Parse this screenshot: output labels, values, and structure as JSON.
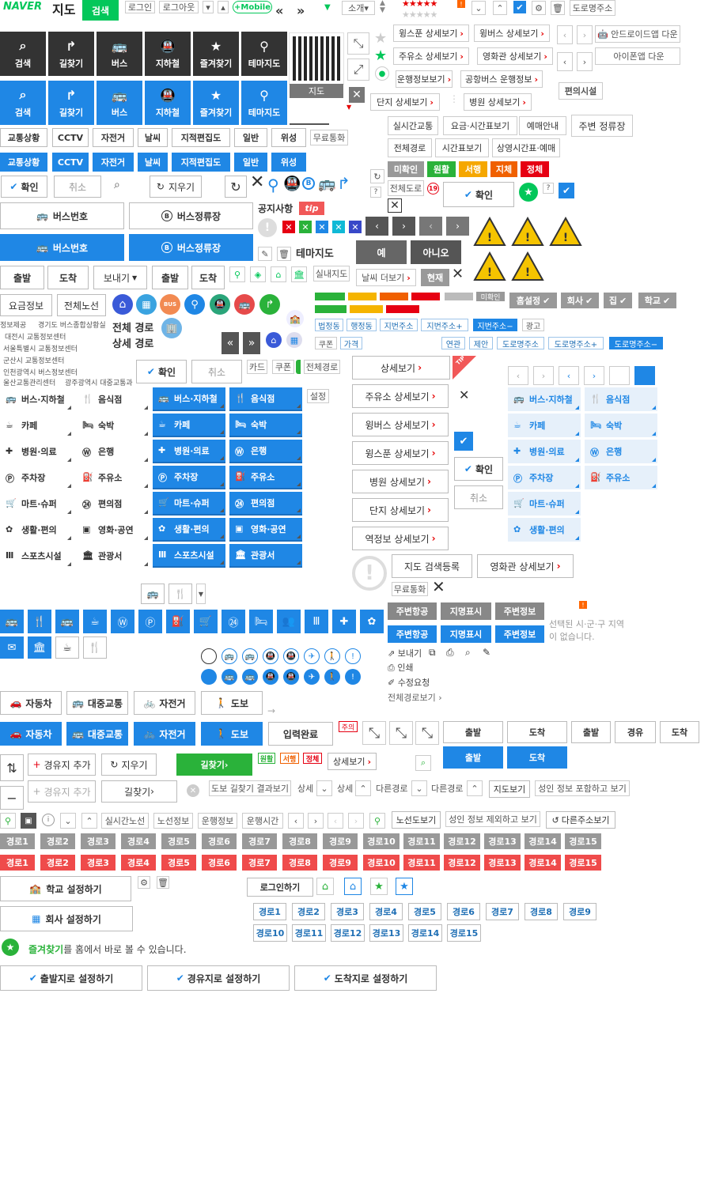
{
  "brand": {
    "naver": "NAVER",
    "title": "지도",
    "search": "검색"
  },
  "top": {
    "login": "로그인",
    "logout": "로그아웃",
    "mobile": "+Mobile",
    "intro": "소개",
    "road_addr": "도로명주소",
    "stars": "★★★★★"
  },
  "app": {
    "android": "안드로이드앱 다운",
    "iphone": "아이폰앱 다운"
  },
  "tiles": [
    "검색",
    "길찾기",
    "버스",
    "지하철",
    "즐겨찾기",
    "테마지도"
  ],
  "qr": {
    "label": "지도"
  },
  "detail_btns": [
    "윙스푼 상세보기",
    "윙버스 상세보기",
    "주유소 상세보기",
    "영화관 상세보기",
    "운행정보보기",
    "공항버스 운행정보",
    "단지 상세보기",
    "병원 상세보기"
  ],
  "conv": "편의시설",
  "traffic": [
    "교통상황",
    "CCTV",
    "자전거",
    "날씨",
    "지적편집도",
    "일반",
    "위성"
  ],
  "free_call": "무료통화",
  "sched": [
    "실시간교통",
    "요금·시간표보기",
    "예매안내",
    "주변 정류장",
    "전체경로",
    "시간표보기",
    "상영시간표·예매"
  ],
  "status": {
    "unknown": "미확인",
    "smooth": "원활",
    "slow": "서행",
    "delay": "지체",
    "jam": "정체"
  },
  "all_road": "전체도로",
  "age": "19",
  "confirm": "확인",
  "cancel": "취소",
  "erase": "지우기",
  "bus_no": "버스번호",
  "bus_stop": "버스정류장",
  "notice": "공지사항",
  "tip": "tip",
  "theme_map": "테마지도",
  "yes": "예",
  "no": "아니오",
  "depart": "출발",
  "arrive": "도착",
  "send": "보내기",
  "indoor": "실내지도",
  "weather_more": "날씨 더보기",
  "now": "현재",
  "fare": "요금정보",
  "all_line": "전체노선",
  "bus_icon": "BUS",
  "prefs": {
    "home": "홈설정",
    "work": "회사",
    "house": "집",
    "school": "학교"
  },
  "addr_tags": [
    "법정동",
    "행정동",
    "지번주소",
    "지번주소+",
    "지번주소−",
    "광고",
    "쿠폰",
    "가격",
    "연관",
    "제안",
    "도로명주소",
    "도로명주소+",
    "도로명주소−"
  ],
  "info_src": [
    "정보제공",
    "경기도 버스종합상황실",
    "대전시 교통정보센터",
    "서울특별시 교통정보센터",
    "군산시 교통정보센터",
    "인천광역시 버스정보센터",
    "울산교통관리센터",
    "광주광역시 대중교통과"
  ],
  "route": {
    "all": "전체 경로",
    "detail": "상세 경로"
  },
  "card": "카드",
  "coupon": "쿠폰",
  "all_route": "전체경로",
  "settings": "설정",
  "detail_view": "상세보기",
  "tip_badge": "TIP",
  "places": [
    "버스·지하철",
    "음식점",
    "카페",
    "숙박",
    "병원·의료",
    "은행",
    "주차장",
    "주유소",
    "마트·슈퍼",
    "편의점",
    "생활·편의",
    "영화·공연",
    "스포츠시설",
    "관광서"
  ],
  "detail_col": [
    "주유소 상세보기",
    "윙버스 상세보기",
    "윙스푼 상세보기",
    "병원 상세보기",
    "단지 상세보기",
    "역정보 상세보기"
  ],
  "map_reg": "지도 검색등록",
  "cinema_detail": "영화관 상세보기",
  "surround": [
    "주변항공",
    "지명표시",
    "주변정보"
  ],
  "no_region": "선택된 시·군·구 지역이 없습니다.",
  "actions": [
    "보내기",
    "인쇄",
    "수정요청",
    "전체경로보기"
  ],
  "modes": [
    "자동차",
    "대중교통",
    "자전거",
    "도보"
  ],
  "input_done": "입력완료",
  "caution": "주의",
  "dep_via": {
    "depart": "출발",
    "arrive": "도착",
    "via": "경유"
  },
  "waypoint_add": "경유지 추가",
  "find_way": "길찾기",
  "walk_result": "도보 길찾기 결과보기",
  "detail": "상세",
  "other_route": "다른경로",
  "map_view": "지도보기",
  "adult_incl": "성인 정보 포함하고 보기",
  "adult_excl": "성인 정보 제외하고 보기",
  "realtime_line": "실시간노선",
  "line_info": "노선정보",
  "run_info": "운행정보",
  "run_time": "운행시간",
  "line_view": "노선도보기",
  "other_addr": "다른주소보기",
  "routes": [
    "경로1",
    "경로2",
    "경로3",
    "경로4",
    "경로5",
    "경로6",
    "경로7",
    "경로8",
    "경로9",
    "경로10",
    "경로11",
    "경로12",
    "경로13",
    "경로14",
    "경로15"
  ],
  "school_set": "학교 설정하기",
  "work_set": "회사 설정하기",
  "login_do": "로그인하기",
  "fav_msg": "즐겨찾기",
  "fav_msg2": "를 홈에서 바로 볼 수 있습니다.",
  "set_depart": "출발지로 설정하기",
  "set_via": "경유지로 설정하기",
  "set_arrive": "도착지로 설정하기"
}
